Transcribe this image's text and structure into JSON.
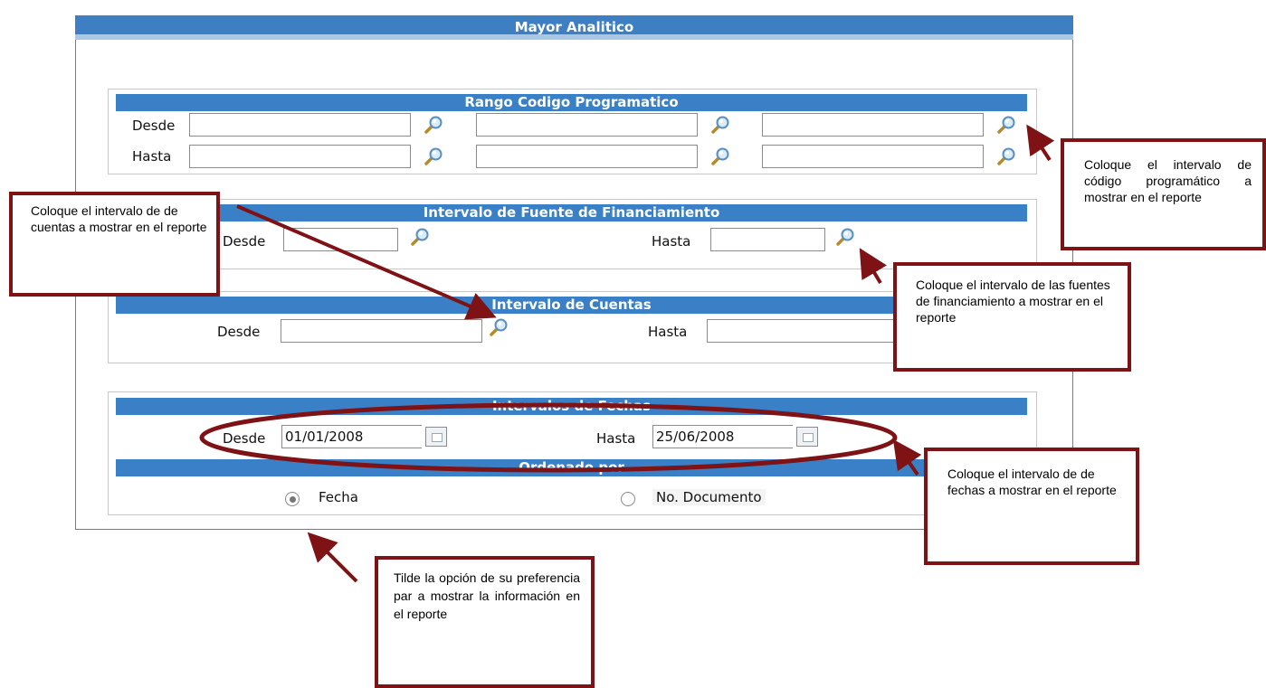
{
  "window": {
    "title": "Mayor Analitico"
  },
  "rango": {
    "title": "Rango Codigo Programatico",
    "desde_label": "Desde",
    "hasta_label": "Hasta"
  },
  "fuente": {
    "title": "Intervalo de Fuente de Financiamiento",
    "desde_label": "Desde",
    "hasta_label": "Hasta"
  },
  "cuentas": {
    "title": "Intervalo de Cuentas",
    "desde_label": "Desde",
    "hasta_label": "Hasta"
  },
  "fechas": {
    "title": "Intervalos de Fechas",
    "desde_label": "Desde",
    "desde_value": "01/01/2008",
    "hasta_label": "Hasta",
    "hasta_value": "25/06/2008"
  },
  "orden": {
    "title": "Ordenado por",
    "options": [
      {
        "label": "Fecha",
        "selected": true
      },
      {
        "label": "No. Documento",
        "selected": false
      }
    ]
  },
  "annotations": {
    "codigo": "Coloque el intervalo de código programático a mostrar en el reporte",
    "cuentas": "Coloque el intervalo de de cuentas a mostrar en el reporte",
    "fuentes": "Coloque el intervalo de  las fuentes de financiamiento a mostrar en el reporte",
    "fechas": "Coloque el intervalo de de fechas a mostrar en el reporte",
    "orden": "Tilde la opción de su preferencia par a mostrar la información en el reporte"
  },
  "colors": {
    "header": "#3e7ec3",
    "bar": "#3a80c6",
    "annotation": "#7f1214"
  },
  "icons": {
    "search": "magnifier-icon",
    "calendar": "calendar-icon"
  }
}
